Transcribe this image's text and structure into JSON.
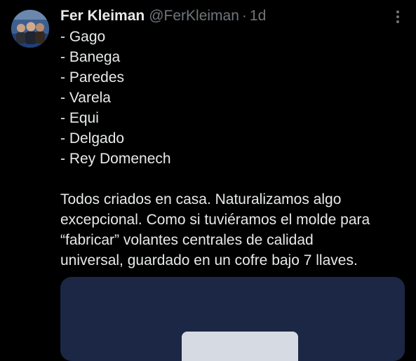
{
  "tweet": {
    "author_name": "Fer Kleiman",
    "author_handle": "@FerKleiman",
    "separator": "·",
    "time": "1d",
    "list": [
      "- Gago",
      "- Banega",
      "- Paredes",
      "- Varela",
      "- Equi",
      "- Delgado",
      "- Rey Domenech"
    ],
    "paragraph_lines": [
      "Todos criados en casa. Naturalizamos algo",
      "excepcional. Como si tuviéramos el molde para",
      "“fabricar” volantes centrales de calidad",
      "universal, guardado en un cofre bajo 7 llaves."
    ]
  },
  "icons": {
    "more": "more-options-icon",
    "avatar": "profile-photo"
  },
  "colors": {
    "background": "#000000",
    "primary_text": "#e7e9ea",
    "secondary_text": "#71767b",
    "media_background": "#1c2745"
  }
}
